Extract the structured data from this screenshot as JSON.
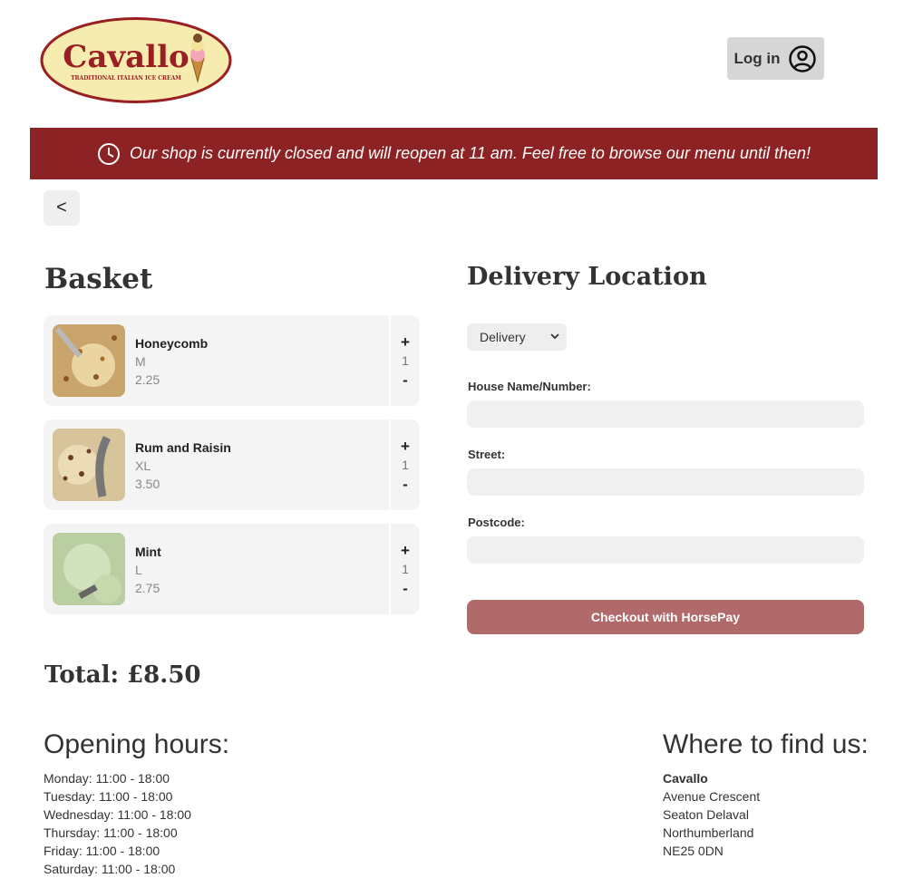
{
  "header": {
    "logo_text": "Cavallo",
    "logo_tagline": "TRADITIONAL ITALIAN ICE CREAM",
    "login_label": "Log in"
  },
  "banner": {
    "message": "Our shop is currently closed and will reopen at 11 am. Feel free to browse our menu until then!"
  },
  "nav": {
    "back_label": "<"
  },
  "basket": {
    "title": "Basket",
    "items": [
      {
        "name": "Honeycomb",
        "size": "M",
        "price": "2.25",
        "quantity": "1",
        "plus": "+",
        "minus": "-"
      },
      {
        "name": "Rum and Raisin",
        "size": "XL",
        "price": "3.50",
        "quantity": "1",
        "plus": "+",
        "minus": "-"
      },
      {
        "name": "Mint",
        "size": "L",
        "price": "2.75",
        "quantity": "1",
        "plus": "+",
        "minus": "-"
      }
    ],
    "total": "Total: £8.50"
  },
  "delivery": {
    "title": "Delivery Location",
    "method_selected": "Delivery",
    "fields": [
      {
        "label": "House Name/Number:",
        "value": ""
      },
      {
        "label": "Street:",
        "value": ""
      },
      {
        "label": "Postcode:",
        "value": ""
      }
    ],
    "checkout_label": "Checkout with HorsePay"
  },
  "footer": {
    "hours_title": "Opening hours:",
    "hours": [
      "Monday: 11:00 - 18:00",
      "Tuesday: 11:00 - 18:00",
      "Wednesday: 11:00 - 18:00",
      "Thursday: 11:00 - 18:00",
      "Friday: 11:00 - 18:00",
      "Saturday: 11:00 - 18:00"
    ],
    "find_title": "Where to find us:",
    "shop_name": "Cavallo",
    "address_lines": [
      "Avenue Crescent",
      "Seaton Delaval",
      "Northumberland",
      "NE25 0DN"
    ]
  },
  "colors": {
    "banner": "#8c2224",
    "checkout": "#b06a6a",
    "logo_fill": "#f6ecb0",
    "logo_text": "#9a1f22"
  }
}
